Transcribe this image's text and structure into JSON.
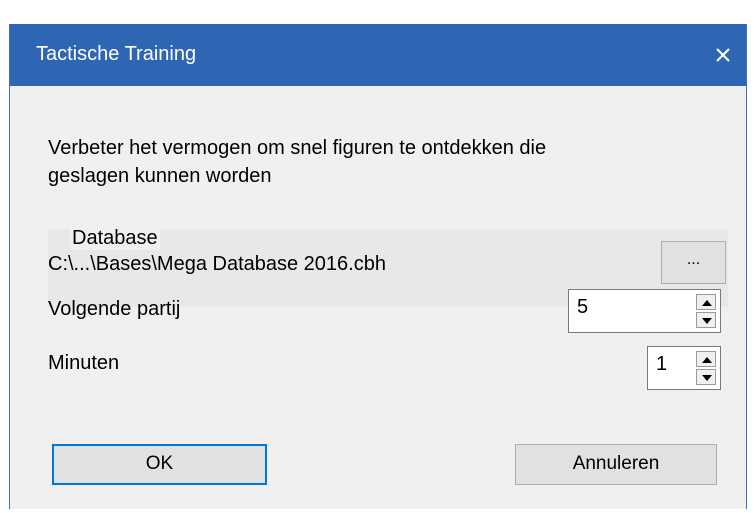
{
  "window": {
    "title": "Tactische Training",
    "close_glyph": "✕"
  },
  "description": {
    "line1": "Verbeter het vermogen om snel figuren te ontdekken die",
    "line2": "geslagen kunnen worden"
  },
  "database": {
    "label": "Database",
    "path": "C:\\...\\Bases\\Mega Database 2016.cbh",
    "browse_label": "..."
  },
  "next_game": {
    "label": "Volgende partij",
    "value": "5"
  },
  "minutes": {
    "label": "Minuten",
    "value": "1"
  },
  "buttons": {
    "ok_label": "OK",
    "cancel_label": "Annuleren"
  },
  "colors": {
    "titlebar": "#2f66b3",
    "dialog_bg": "#f0f0f0",
    "default_button_border": "#0078d7"
  }
}
